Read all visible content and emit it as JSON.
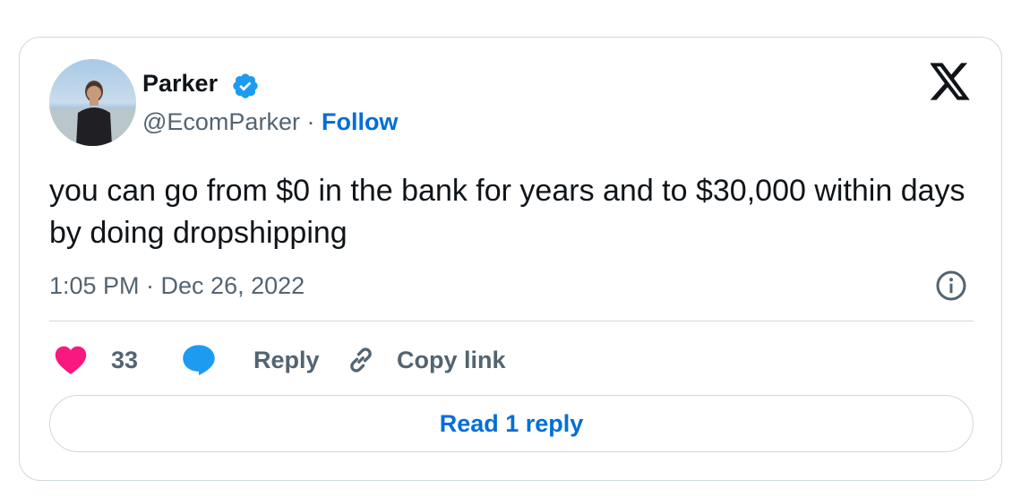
{
  "author": {
    "name": "Parker",
    "handle": "@EcomParker",
    "separator": " · ",
    "follow_label": "Follow",
    "avatar_icon": "profile-photo",
    "verified_icon": "verified-badge-icon"
  },
  "brand_icon": "x-logo-icon",
  "tweet": {
    "text": "you can go from $0 in the bank for years and to $30,000 within days by doing dropshipping",
    "timestamp": "1:05 PM · Dec 26, 2022"
  },
  "info_icon": "info-icon",
  "actions": {
    "like_count": "33",
    "reply_label": "Reply",
    "copy_label": "Copy link"
  },
  "read_replies_label": "Read 1 reply",
  "colors": {
    "accent": "#006fd6",
    "verified": "#1d9bf0",
    "heart": "#f91880",
    "text_primary": "#0f1419",
    "text_secondary": "#536471",
    "border": "#cfd9de"
  }
}
